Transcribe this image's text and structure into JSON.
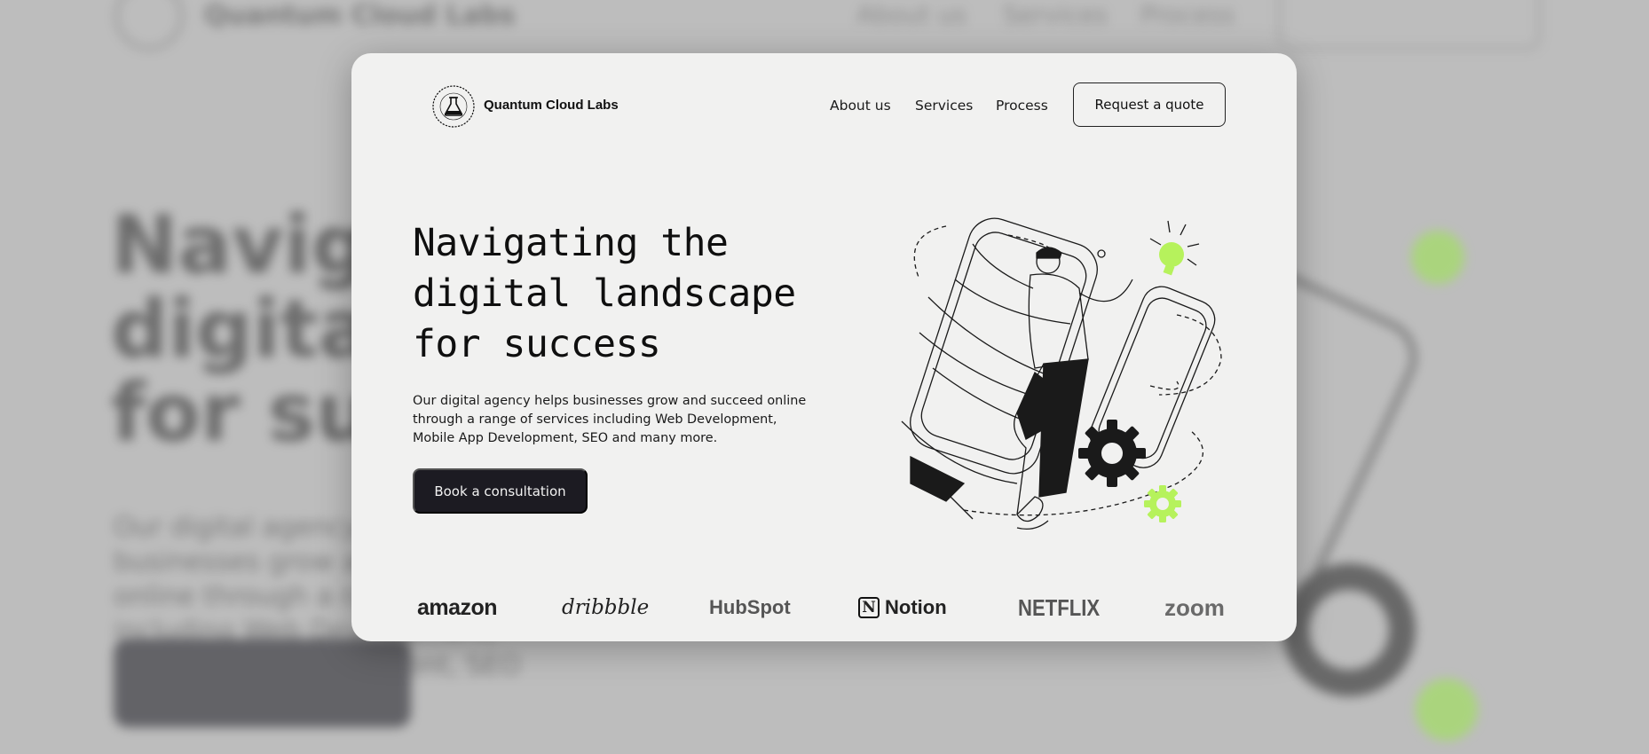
{
  "brand": {
    "name": "Quantum Cloud Labs",
    "seal_text": "Quantum Cloud Labs"
  },
  "nav": {
    "about": "About us",
    "services": "Services",
    "process": "Process",
    "quote": "Request a quote"
  },
  "hero": {
    "title": "Navigating the\ndigital landscape\nfor success",
    "description": "Our digital agency helps businesses grow and succeed online through a range of services including Web Development, Mobile App Development, SEO and many more.",
    "cta": "Book a consultation"
  },
  "clients": [
    "amazon",
    "dribbble",
    "HubSpot",
    "Notion",
    "NETFLIX",
    "zoom"
  ],
  "colors": {
    "accent": "#b6f25c",
    "dark": "#1c1b22",
    "card": "#f1f1f0"
  },
  "icons": {
    "logo": "flask-seal-icon",
    "illustration": "person-with-devices-illustration"
  }
}
